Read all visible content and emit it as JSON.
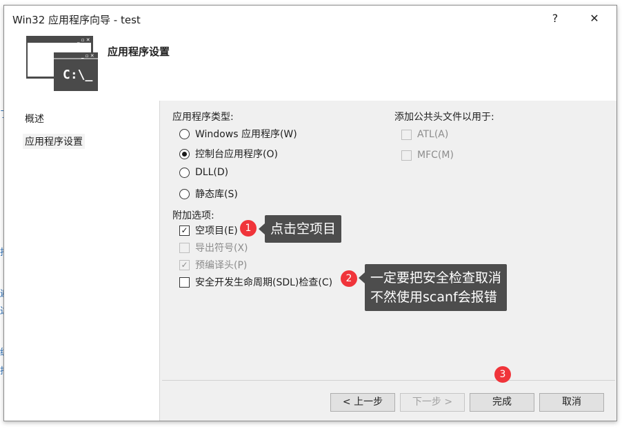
{
  "window": {
    "title": "Win32 应用程序向导 - test",
    "help": "?",
    "close": "✕"
  },
  "banner": {
    "title": "应用程序设置",
    "icon_text": "C:\\_"
  },
  "nav": {
    "items": [
      {
        "label": "概述"
      },
      {
        "label": "应用程序设置"
      }
    ]
  },
  "app_type": {
    "label": "应用程序类型:",
    "options": [
      {
        "label": "Windows 应用程序(W)",
        "selected": false
      },
      {
        "label": "控制台应用程序(O)",
        "selected": true
      },
      {
        "label": "DLL(D)",
        "selected": false
      },
      {
        "label": "静态库(S)",
        "selected": false
      }
    ]
  },
  "extra": {
    "label": "附加选项:",
    "options": [
      {
        "label": "空项目(E)",
        "checked": true,
        "enabled": true
      },
      {
        "label": "导出符号(X)",
        "checked": false,
        "enabled": false
      },
      {
        "label": "预编译头(P)",
        "checked": true,
        "enabled": false
      },
      {
        "label": "安全开发生命周期(SDL)检查(C)",
        "checked": false,
        "enabled": true
      }
    ]
  },
  "headers": {
    "label": "添加公共头文件以用于:",
    "options": [
      {
        "label": "ATL(A)",
        "checked": false,
        "enabled": false
      },
      {
        "label": "MFC(M)",
        "checked": false,
        "enabled": false
      }
    ]
  },
  "buttons": {
    "prev": "< 上一步",
    "next": "下一步 >",
    "finish": "完成",
    "cancel": "取消"
  },
  "annotations": {
    "badge1": "1",
    "badge2": "2",
    "badge3": "3",
    "callout1": "点击空项目",
    "callout2_line1": "一定要把安全检查取消",
    "callout2_line2": "不然使用scanf会报错"
  },
  "colors": {
    "badge": "#f0343a",
    "callout": "#4d4d4d"
  }
}
